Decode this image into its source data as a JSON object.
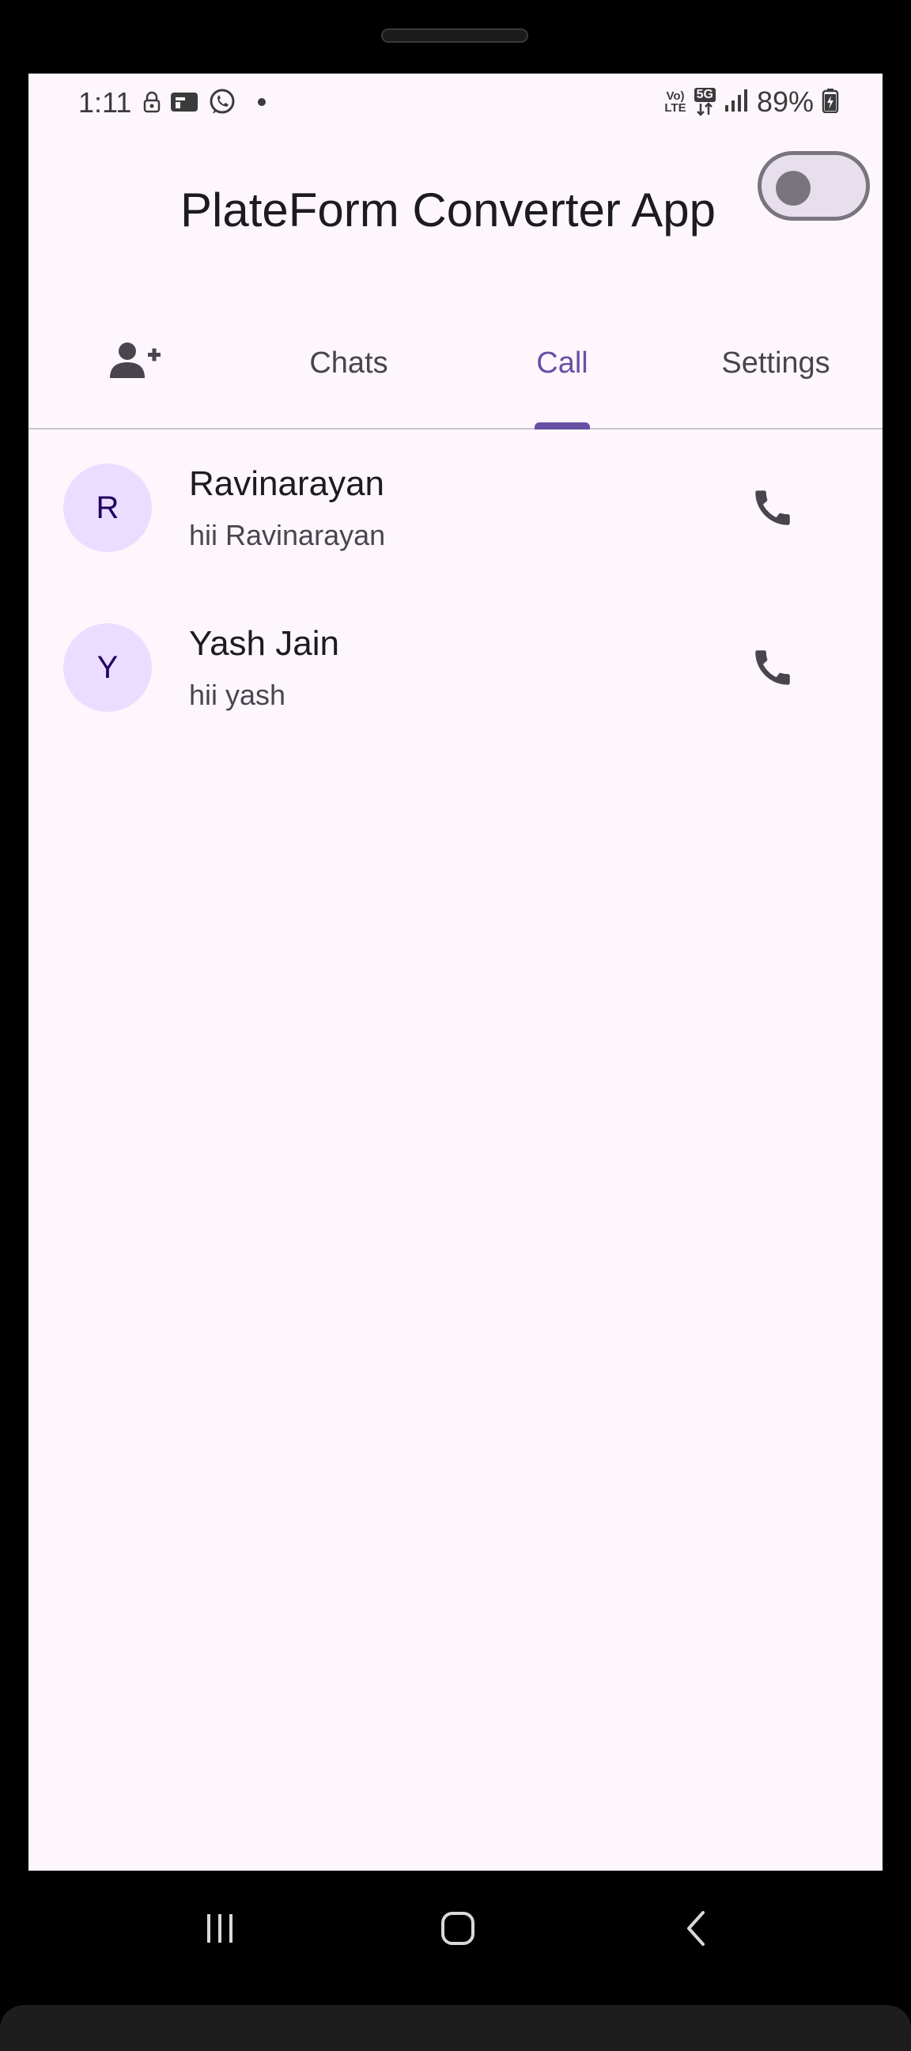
{
  "status_bar": {
    "time": "1:11",
    "battery": "89%",
    "network_top": "Vo)",
    "network_bottom": "LTE",
    "network_type": "5G"
  },
  "app_bar": {
    "title": "PlateForm Converter App",
    "dark_mode_toggle_on": false
  },
  "tabs": [
    {
      "label": "",
      "icon": "person-add-icon",
      "active": false
    },
    {
      "label": "Chats",
      "active": false
    },
    {
      "label": "Call",
      "active": true
    },
    {
      "label": "Settings",
      "active": false
    }
  ],
  "calls": [
    {
      "initial": "R",
      "name": "Ravinarayan",
      "message": "hii Ravinarayan",
      "action_icon": "phone-icon"
    },
    {
      "initial": "Y",
      "name": "Yash Jain",
      "message": "hii yash",
      "action_icon": "phone-icon"
    }
  ],
  "nav_bar": {
    "recents_icon": "recents-icon",
    "home_icon": "home-icon",
    "back_icon": "back-icon"
  },
  "colors": {
    "primary": "#6750a4",
    "background": "#fdf7fd",
    "avatar_bg": "#eaddff",
    "avatar_text": "#21005d",
    "text_primary": "#1c1b1f",
    "text_secondary": "#49454f"
  }
}
